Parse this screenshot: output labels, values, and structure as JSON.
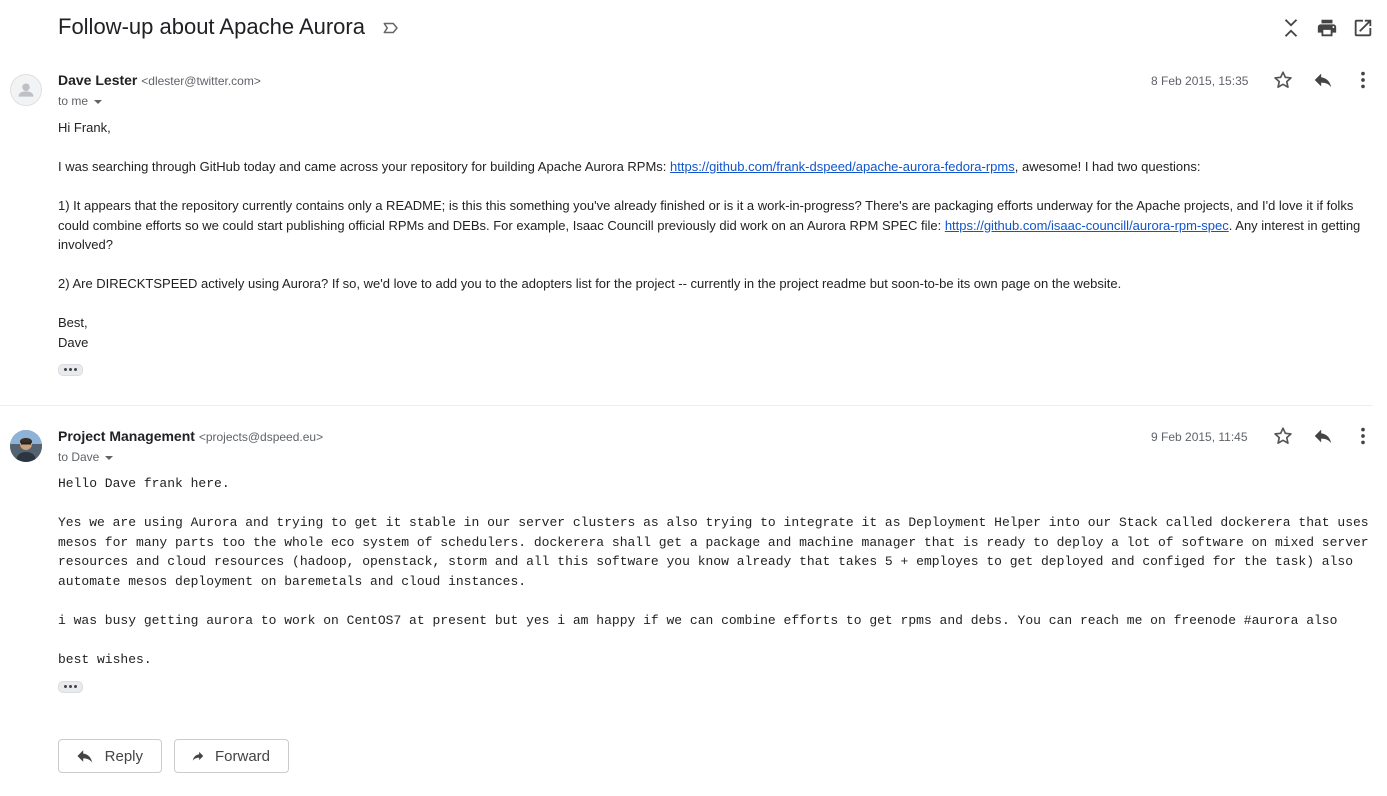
{
  "thread": {
    "subject": "Follow-up about Apache Aurora"
  },
  "icons": {
    "label": "label-outline-icon",
    "collapse": "collapse-all-icon",
    "print": "print-icon",
    "open": "open-in-new-window-icon",
    "star": "star-outline-icon",
    "reply": "reply-icon",
    "more": "more-vert-icon",
    "forward": "forward-icon"
  },
  "message1": {
    "sender_name": "Dave Lester",
    "sender_email": "<dlester@twitter.com>",
    "recipient": "to me",
    "date": "8 Feb 2015, 15:35",
    "greeting": "Hi Frank,",
    "p1_pre": "I was searching through GitHub today and came across your repository for building Apache Aurora RPMs: ",
    "p1_link": "https://github.com/frank-dspeed/apache-aurora-fedora-rpms",
    "p1_post": ", awesome! I had two questions:",
    "p2_pre": "1) It appears that the repository currently contains only a README; is this this something you've already finished or is it a work-in-progress? There's are packaging efforts underway for the Apache projects, and I'd love it if folks could combine efforts so we could start publishing official RPMs and DEBs. For example, Isaac Councill previously did work on an Aurora RPM SPEC file: ",
    "p2_link": "https://github.com/isaac-councill/aurora-rpm-spec",
    "p2_post": ". Any interest in getting involved?",
    "p3": "2) Are DIRECKTSPEED actively using Aurora? If so, we'd love to add you to the adopters list for the project -- currently in the project readme but soon-to-be its own page on the website.",
    "signoff": "Best,",
    "signature": "Dave"
  },
  "message2": {
    "sender_name": "Project Management",
    "sender_email": "<projects@dspeed.eu>",
    "recipient": "to Dave",
    "date": "9 Feb 2015, 11:45",
    "p1": "Hello Dave frank here.",
    "p2": "Yes we are using Aurora and trying to get it stable in our server clusters as also trying to integrate it as Deployment Helper into our Stack called dockerera that uses mesos for many parts too the whole eco system of schedulers. dockerera shall get a package and machine manager that is ready to deploy a lot of software on mixed server resources and cloud resources (hadoop, openstack, storm and all this software you know already that takes 5 + employes to get deployed and configed for the task) also automate mesos deployment on baremetals and cloud instances.",
    "p3": "i was busy getting aurora to work on CentOS7 at present but yes i am happy if we can combine efforts to get rpms and debs. You can reach me on freenode #aurora also",
    "p4": "best wishes."
  },
  "actions": {
    "reply_label": "Reply",
    "forward_label": "Forward"
  }
}
